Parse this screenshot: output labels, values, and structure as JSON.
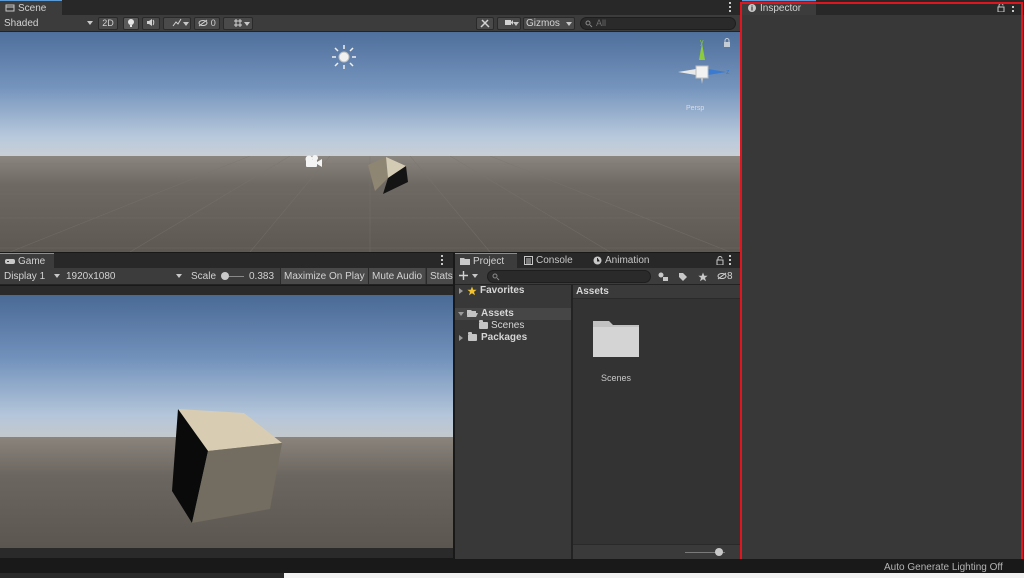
{
  "scene": {
    "tab_label": "Scene",
    "shading_mode": "Shaded",
    "mode_2d": "2D",
    "fx_count": "0",
    "gizmos_label": "Gizmos",
    "search_placeholder": "All",
    "axis_y": "y",
    "axis_z": "z",
    "view_label": "Persp"
  },
  "game": {
    "tab_label": "Game",
    "display": "Display 1",
    "resolution": "1920x1080",
    "scale_label": "Scale",
    "scale_value": "0.383",
    "maximize_label": "Maximize On Play",
    "mute_label": "Mute Audio",
    "stats_label": "Stats"
  },
  "project": {
    "tabs": [
      "Project",
      "Console",
      "Animation"
    ],
    "hidden_count": "8",
    "favorites_label": "Favorites",
    "tree": {
      "assets": "Assets",
      "scenes": "Scenes",
      "packages": "Packages"
    },
    "breadcrumb": "Assets",
    "grid_items": [
      {
        "label": "Scenes",
        "icon": "folder-icon"
      }
    ],
    "thumb_size": 0.85
  },
  "inspector": {
    "tab_label": "Inspector",
    "highlight_color": "#e0161e"
  },
  "status_bar": {
    "text": "Auto Generate Lighting Off"
  }
}
